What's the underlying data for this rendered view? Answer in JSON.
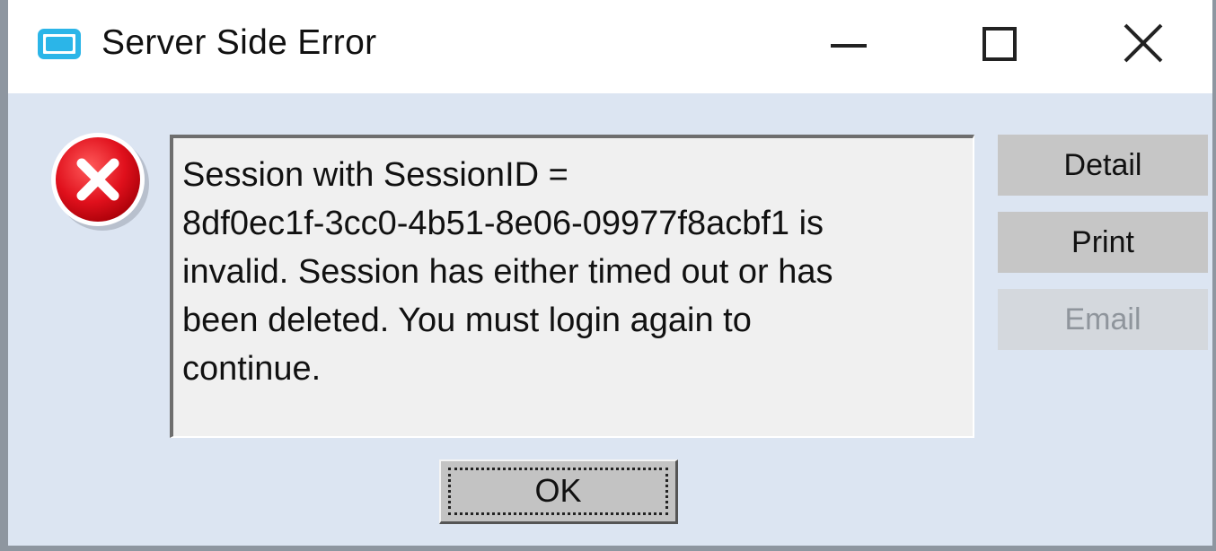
{
  "window": {
    "title": "Server Side Error",
    "icon": "app-window-icon",
    "controls": {
      "minimize": "minimize-icon",
      "maximize": "maximize-icon",
      "close": "close-icon"
    }
  },
  "dialog": {
    "icon": "error-icon",
    "message_lines": [
      "Session with SessionID =",
      "8df0ec1f-3cc0-4b51-8e06-09977f8acbf1 is",
      "invalid. Session has either timed out or has",
      "been deleted. You must login again to",
      "continue."
    ],
    "buttons": {
      "detail": "Detail",
      "print": "Print",
      "email": "Email",
      "ok": "OK"
    }
  },
  "colors": {
    "error_red": "#e0101c",
    "accent_blue": "#2bb5e8",
    "dialog_bg": "#dce5f2",
    "disabled_text": "#8f959c"
  }
}
